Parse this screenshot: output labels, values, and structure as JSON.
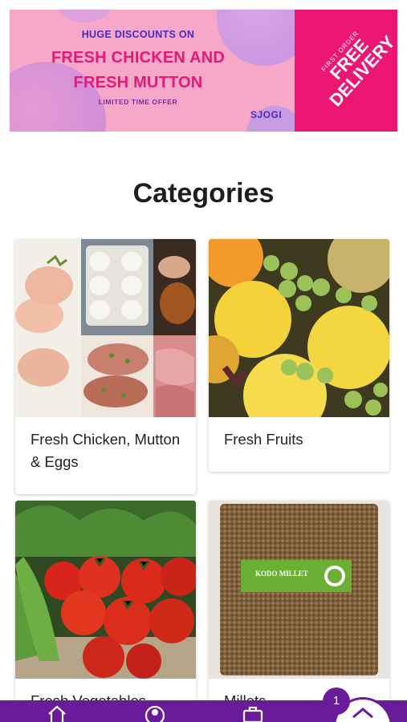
{
  "banner": {
    "top_line": "HUGE DISCOUNTS ON",
    "main_line_1": "FRESH CHICKEN AND",
    "main_line_2": "FRESH MUTTON",
    "sub_line": "LIMITED TIME OFFER",
    "brand": "SJOGI",
    "side_small": "FIRST ORDER",
    "side_big_1": "FREE",
    "side_big_2": "DELIVERY",
    "colors": {
      "pink_bg": "#f7a7c8",
      "accent": "#ec1675",
      "purple_text": "#4a2bbf"
    }
  },
  "section_title": "Categories",
  "categories": [
    {
      "label": "Fresh Chicken, Mutton & Eggs"
    },
    {
      "label": "Fresh Fruits"
    },
    {
      "label": "Fresh Vegetables"
    },
    {
      "label": "Millets",
      "package_label": "KODO MILLET"
    }
  ],
  "cart": {
    "count": "1"
  },
  "nav": {
    "items": [
      {
        "icon": "home-icon"
      },
      {
        "icon": "account-icon"
      },
      {
        "icon": "briefcase-icon"
      }
    ],
    "fab_icon": "chevron-up-icon",
    "color": "#6a1b9a"
  }
}
